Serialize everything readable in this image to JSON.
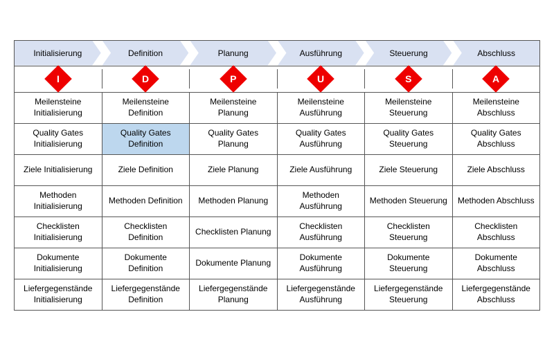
{
  "phases": [
    {
      "label": "Initialisierung",
      "letter": "I"
    },
    {
      "label": "Definition",
      "letter": "D"
    },
    {
      "label": "Planung",
      "letter": "P"
    },
    {
      "label": "Ausführung",
      "letter": "U"
    },
    {
      "label": "Steuerung",
      "letter": "S"
    },
    {
      "label": "Abschluss",
      "letter": "A"
    }
  ],
  "rows": [
    [
      "Meilensteine Initialisierung",
      "Meilensteine Definition",
      "Meilensteine Planung",
      "Meilensteine Ausführung",
      "Meilensteine Steuerung",
      "Meilensteine Abschluss"
    ],
    [
      "Quality Gates Initialisierung",
      "Quality Gates Definition",
      "Quality Gates Planung",
      "Quality Gates Ausführung",
      "Quality Gates Steuerung",
      "Quality Gates Abschluss"
    ],
    [
      "Ziele Initialisierung",
      "Ziele Definition",
      "Ziele Planung",
      "Ziele Ausführung",
      "Ziele Steuerung",
      "Ziele Abschluss"
    ],
    [
      "Methoden Initialisierung",
      "Methoden Definition",
      "Methoden Planung",
      "Methoden Ausführung",
      "Methoden Steuerung",
      "Methoden Abschluss"
    ],
    [
      "Checklisten Initialisierung",
      "Checklisten Definition",
      "Checklisten Planung",
      "Checklisten Ausführung",
      "Checklisten Steuerung",
      "Checklisten Abschluss"
    ],
    [
      "Dokumente Initialisierung",
      "Dokumente Definition",
      "Dokumente Planung",
      "Dokumente Ausführung",
      "Dokumente Steuerung",
      "Dokumente Abschluss"
    ],
    [
      "Liefergegen­stände Initialisierung",
      "Liefergegen­stände Definition",
      "Liefergegen­stände Planung",
      "Liefergegen­stände Ausführung",
      "Liefergegen­stände Steuerung",
      "Liefergegen­stände Abschluss"
    ]
  ],
  "highlighted": {
    "row": 1,
    "col": 1
  }
}
